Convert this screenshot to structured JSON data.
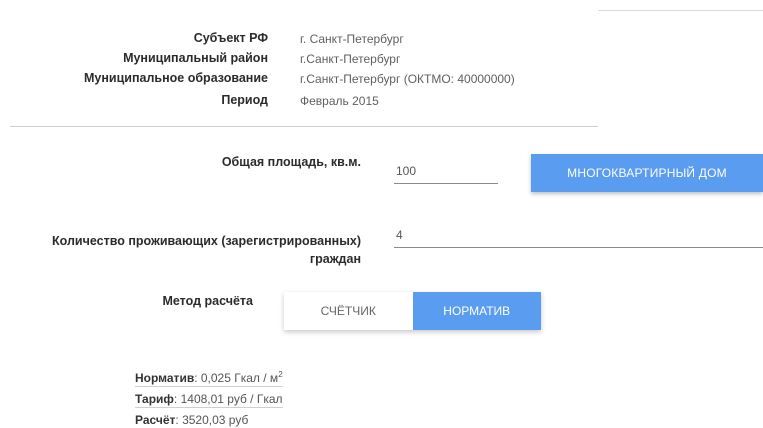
{
  "info": {
    "rows": [
      {
        "label": "Субъект РФ",
        "value": "г. Санкт-Петербург"
      },
      {
        "label": "Муниципальный район",
        "value": "г.Санкт-Петербург"
      },
      {
        "label": "Муниципальное образование",
        "value": "г.Санкт-Петербург (ОКТМО: 40000000)"
      },
      {
        "label": "Период",
        "value": "Февраль 2015"
      }
    ]
  },
  "form": {
    "area_label": "Общая площадь, кв.м.",
    "area_value": "100",
    "building_button": "МНОГОКВАРТИРНЫЙ ДОМ",
    "residents_label_line1": "Количество проживающих (зарегистрированных)",
    "residents_label_line2": "граждан",
    "residents_value": "4",
    "method_label": "Метод расчёта",
    "method_options": [
      "СЧЁТЧИК",
      "НОРМАТИВ"
    ],
    "method_selected": "НОРМАТИВ"
  },
  "results": {
    "norm_label": "Норматив",
    "norm_value": ": 0,025 Гкал / м",
    "norm_sup": "2",
    "tariff_label": "Тариф",
    "tariff_value": ": 1408,01 руб / Гкал",
    "calc_label": "Расчёт",
    "calc_value": ": 3520,03 руб"
  },
  "colors": {
    "accent": "#5a9cf0"
  }
}
